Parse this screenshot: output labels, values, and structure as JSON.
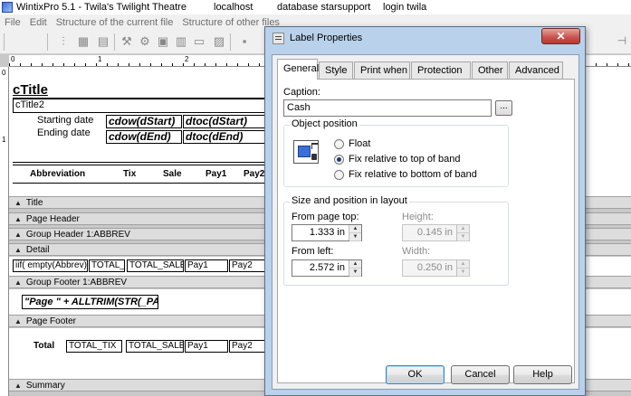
{
  "window": {
    "title": "WintixPro 5.1 - Twila's Twilight Theatre",
    "host": "localhost",
    "database": "database starsupport",
    "login": "login twila"
  },
  "menu": [
    "File",
    "Edit",
    "Structure of the current file",
    "Structure of other files"
  ],
  "ruler": {
    "h": [
      "0",
      "1",
      "2",
      "3",
      "4",
      "5"
    ],
    "v": [
      "0",
      "1"
    ]
  },
  "report": {
    "title_field": "cTitle",
    "title2_field": "cTitle2",
    "starting_date_label": "Starting date",
    "ending_date_label": "Ending date",
    "start_dow": "cdow(dStart)",
    "start_dtoc": "dtoc(dStart)",
    "end_dow": "cdow(dEnd)",
    "end_dtoc": "dtoc(dEnd)",
    "columns": [
      "Abbreviation",
      "Tix",
      "Sale",
      "Pay1",
      "Pay2"
    ],
    "bands": {
      "title": "Title",
      "page_header": "Page Header",
      "group_header": "Group Header 1:ABBREV",
      "detail": "Detail",
      "group_footer": "Group Footer 1:ABBREV",
      "page_footer": "Page Footer",
      "summary": "Summary"
    },
    "detail_fields": [
      "iif( empty(Abbrev),",
      "TOTAL_",
      "TOTAL_SALE",
      "Pay1",
      "Pay2"
    ],
    "group_footer_field": "\"Page \" + ALLTRIM(STR(_PA",
    "page_footer_total_label": "Total",
    "page_footer_fields": [
      "TOTAL_TIX",
      "TOTAL_SALE",
      "Pay1",
      "Pay2"
    ]
  },
  "dialog": {
    "title": "Label Properties",
    "close_label": "✕",
    "tabs": [
      "General",
      "Style",
      "Print when",
      "Protection",
      "Other",
      "Advanced"
    ],
    "caption_label": "Caption:",
    "caption_value": "Cash",
    "ellipsis_label": "...",
    "object_position_title": "Object position",
    "radio_options": [
      "Float",
      "Fix relative to top of band",
      "Fix relative to bottom of band"
    ],
    "radio_selected_index": 1,
    "size_group_title": "Size and position in layout",
    "from_page_top_label": "From page top:",
    "from_page_top_value": "1.333 in",
    "height_label": "Height:",
    "height_value": "0.145 in",
    "from_left_label": "From left:",
    "from_left_value": "2.572 in",
    "width_label": "Width:",
    "width_value": "0.250 in",
    "buttons": {
      "ok": "OK",
      "cancel": "Cancel",
      "help": "Help"
    }
  }
}
